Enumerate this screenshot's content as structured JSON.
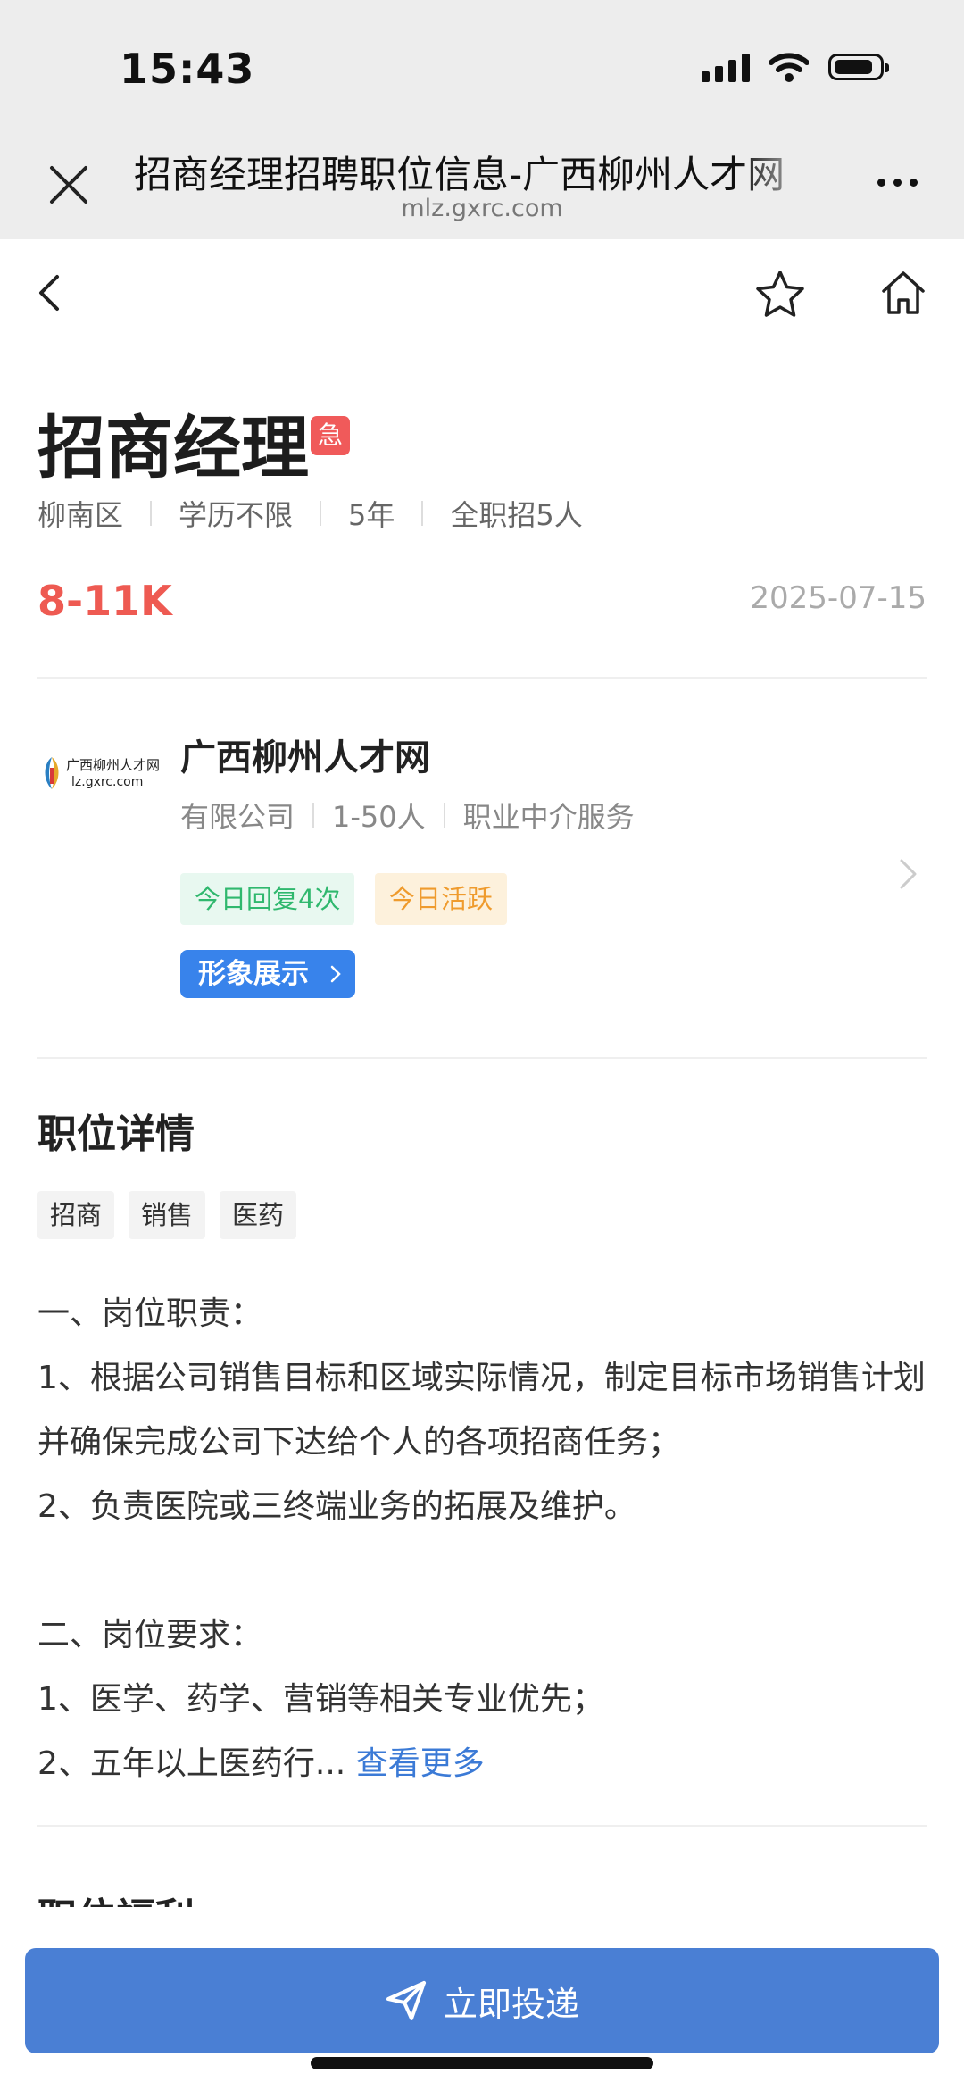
{
  "status_bar": {
    "time": "15:43"
  },
  "browser": {
    "title": "招商经理招聘职位信息-广西柳州人才网",
    "url": "mlz.gxrc.com"
  },
  "job": {
    "title": "招商经理",
    "urgent_badge": "急",
    "meta": [
      "柳南区",
      "学历不限",
      "5年",
      "全职招5人"
    ],
    "salary": "8-11K",
    "date": "2025-07-15"
  },
  "company": {
    "logo_text_line1": "广西柳州人才网",
    "logo_text_line2": "lz.gxrc.com",
    "name": "广西柳州人才网",
    "meta": [
      "有限公司",
      "1-50人",
      "职业中介服务"
    ],
    "tag_reply": "今日回复4次",
    "tag_active": "今日活跃",
    "image_button": "形象展示"
  },
  "details": {
    "section_title": "职位详情",
    "tags": [
      "招商",
      "销售",
      "医药"
    ],
    "description": "一、岗位职责：\n1、根据公司销售目标和区域实际情况，制定目标市场销售计划并确保完成公司下达给个人的各项招商任务；\n2、负责医院或三终端业务的拓展及维护。\n\n二、岗位要求：\n1、医学、药学、营销等相关专业优先；\n2、五年以上医药行... ",
    "see_more": "查看更多",
    "next_section_title": "职位福利"
  },
  "apply_button": "立即投递",
  "colors": {
    "accent_blue": "#4a7fd4",
    "salary_red": "#ee5a52",
    "urgent_red": "#f05a5a"
  }
}
